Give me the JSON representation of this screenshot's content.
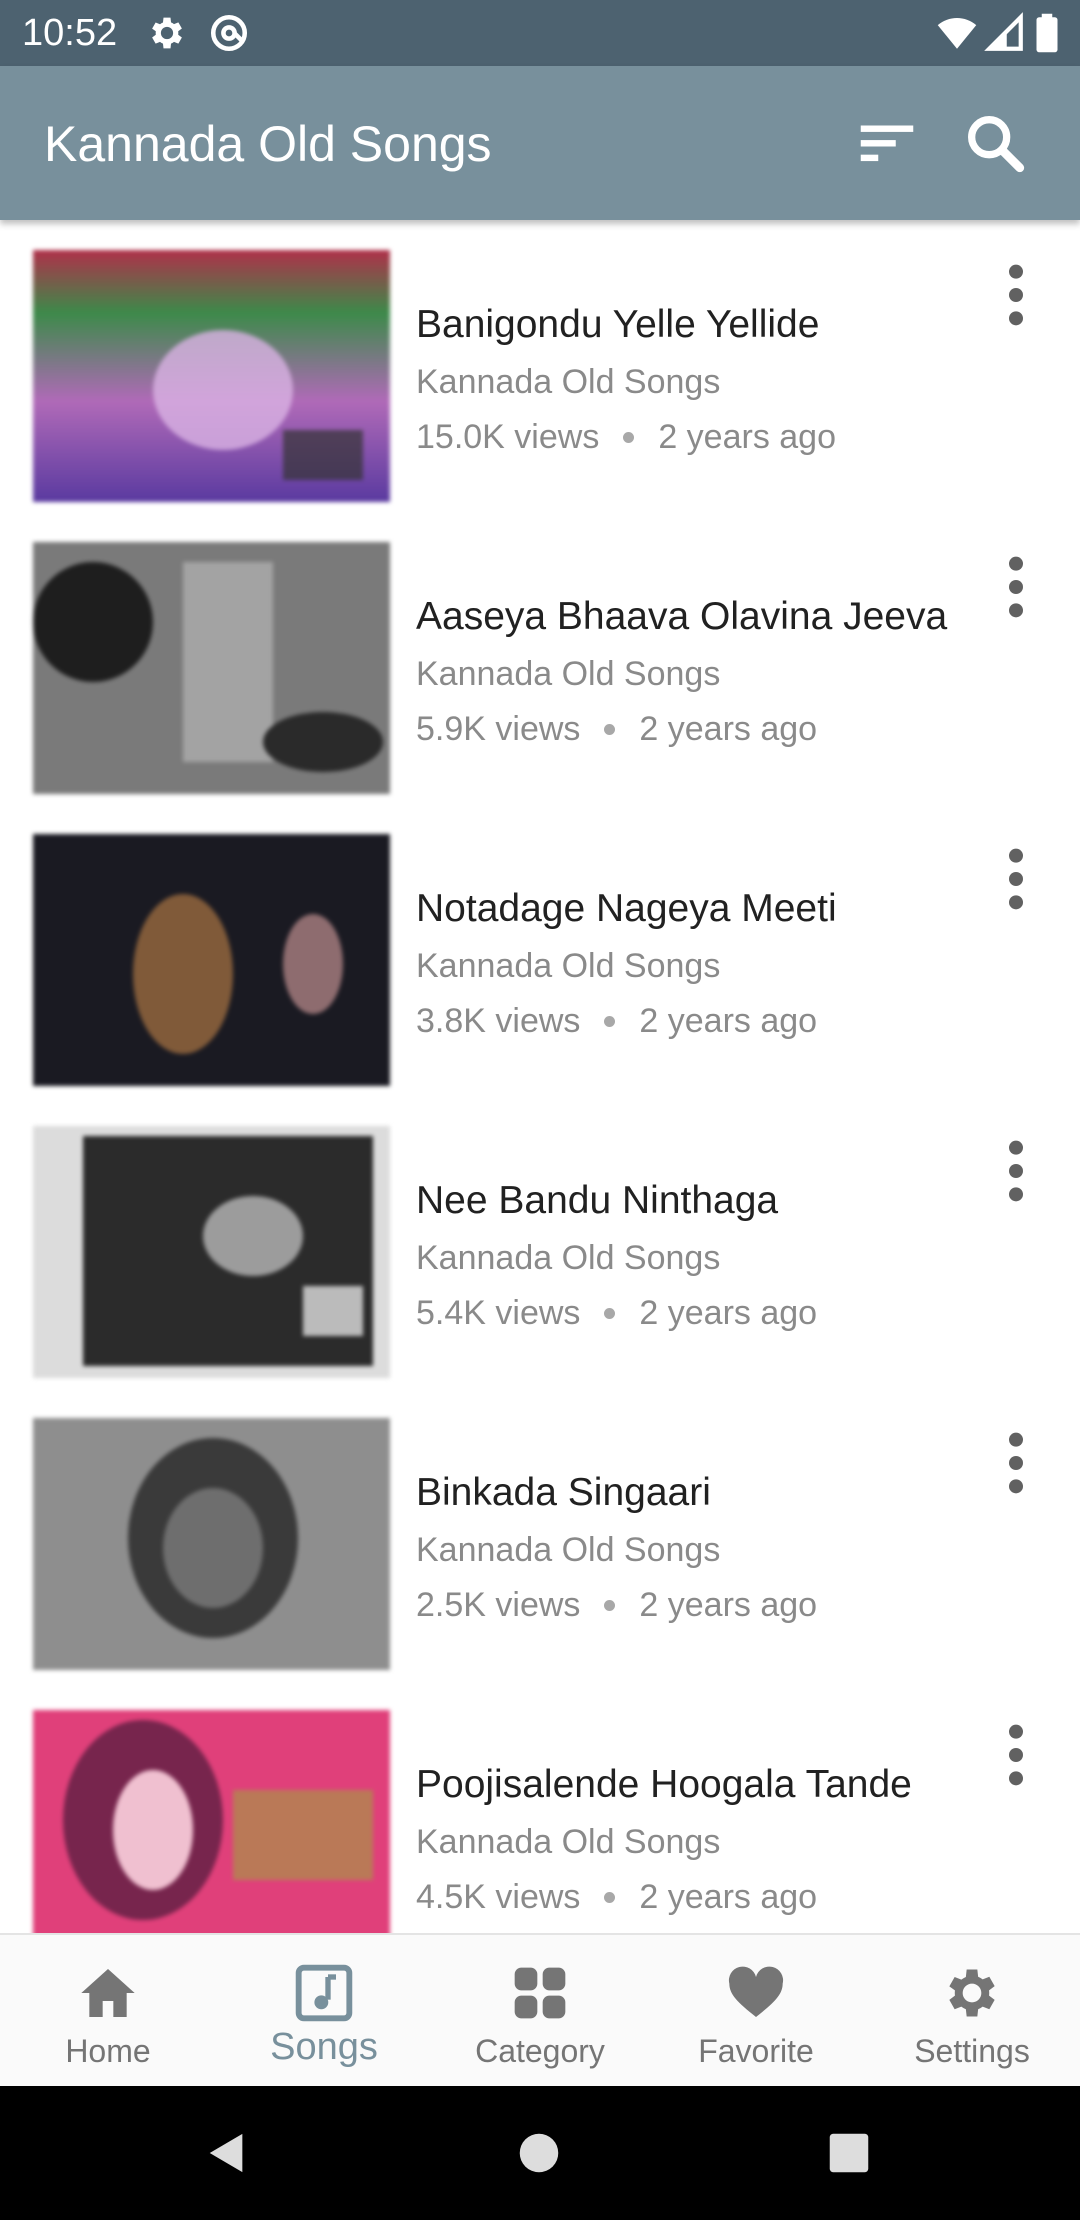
{
  "status_bar": {
    "time": "10:52",
    "left_icons": [
      "gear-icon",
      "at-sign-icon"
    ],
    "right_icons": [
      "wifi-icon",
      "signal-icon",
      "battery-icon"
    ]
  },
  "app_bar": {
    "title": "Kannada Old Songs",
    "actions": [
      "sort-icon",
      "search-icon"
    ],
    "color": "#78909c"
  },
  "songs": [
    {
      "title": "Banigondu Yelle Yellide",
      "channel": "Kannada Old Songs",
      "views": "15.0K views",
      "age": "2 years ago"
    },
    {
      "title": "Aaseya Bhaava Olavina Jeeva",
      "channel": "Kannada Old Songs",
      "views": "5.9K views",
      "age": "2 years ago"
    },
    {
      "title": "Notadage Nageya Meeti",
      "channel": "Kannada Old Songs",
      "views": "3.8K views",
      "age": "2 years ago"
    },
    {
      "title": "Nee Bandu Ninthaga",
      "channel": "Kannada Old Songs",
      "views": "5.4K views",
      "age": "2 years ago"
    },
    {
      "title": "Binkada Singaari",
      "channel": "Kannada Old Songs",
      "views": "2.5K views",
      "age": "2 years ago"
    },
    {
      "title": "Poojisalende Hoogala Tande",
      "channel": "Kannada Old Songs",
      "views": "4.5K views",
      "age": "2 years ago"
    }
  ],
  "bottom_nav": {
    "items": [
      {
        "label": "Home",
        "icon": "home-icon"
      },
      {
        "label": "Songs",
        "icon": "music-note-icon"
      },
      {
        "label": "Category",
        "icon": "grid-icon"
      },
      {
        "label": "Favorite",
        "icon": "heart-icon"
      },
      {
        "label": "Settings",
        "icon": "gear-icon"
      }
    ],
    "active": "Songs",
    "active_color": "#78909c"
  }
}
